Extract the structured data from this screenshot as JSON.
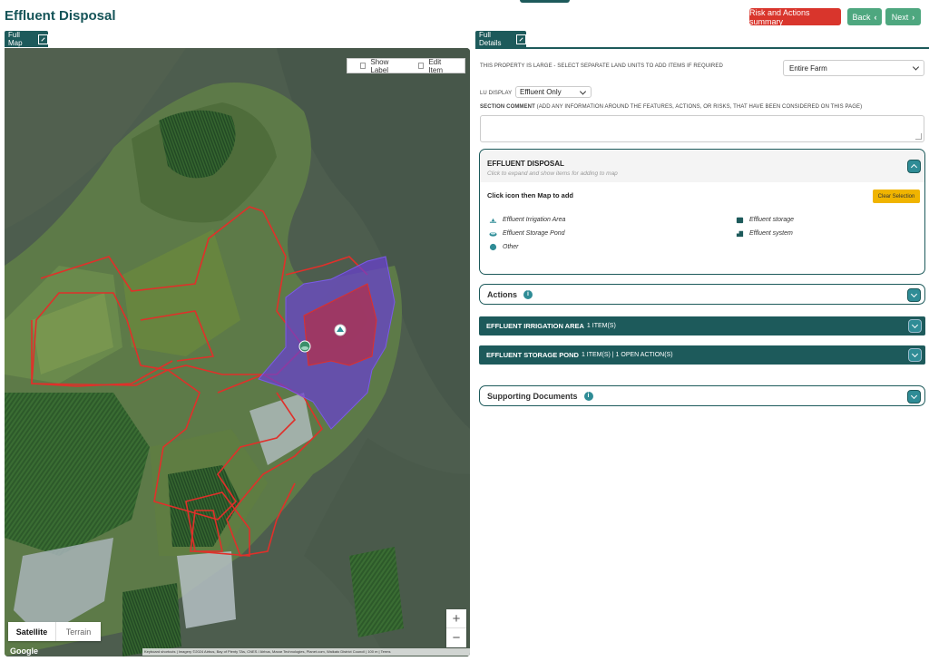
{
  "header": {
    "title": "Effluent Disposal",
    "risk_button": "Risk and Actions summary",
    "back_button": "Back",
    "next_button": "Next"
  },
  "tabs": {
    "map": "Full Map",
    "details": "Full Details"
  },
  "map": {
    "show_label": "Show Label",
    "edit_item": "Edit Item",
    "map_type_satellite": "Satellite",
    "map_type_terrain": "Terrain",
    "zoom_in": "+",
    "zoom_out": "−",
    "google": "Google",
    "attribution": "Keyboard shortcuts | Imagery ©2024 Airbus, Bay of Plenty TAs, CNES / Airbus, Maxar Technologies, Planet.com, Waikato District Council | 100 m | Terms"
  },
  "details": {
    "land_units_label": "THIS PROPERTY IS LARGE - SELECT SEPARATE LAND UNITS TO ADD ITEMS IF REQUIRED",
    "land_units_value": "Entire Farm",
    "lu_display_label": "LU DISPLAY",
    "lu_display_value": "Effluent Only",
    "section_comment_bold": "SECTION COMMENT",
    "section_comment_rest": " (ADD ANY INFORMATION AROUND THE FEATURES, ACTIONS, OR RISKS, THAT HAVE BEEN CONSIDERED ON THIS PAGE)"
  },
  "effluent_panel": {
    "title": "EFFLUENT DISPOSAL",
    "subtitle": "Click to expand and show items for adding to map",
    "instruction": "Click icon then Map to add",
    "clear_button": "Clear Selection",
    "items": [
      {
        "label": "Effluent Irrigation Area",
        "icon": "irrigation-icon"
      },
      {
        "label": "Effluent storage",
        "icon": "storage-icon"
      },
      {
        "label": "Effluent Storage Pond",
        "icon": "pond-icon"
      },
      {
        "label": "Effluent system",
        "icon": "system-icon"
      },
      {
        "label": "Other",
        "icon": "other-icon"
      }
    ]
  },
  "accordions": {
    "actions": "Actions",
    "irrigation_title": "EFFLUENT IRRIGATION AREA",
    "irrigation_extra": "1 ITEM(S)",
    "pond_title": "EFFLUENT STORAGE POND",
    "pond_extra": "1 ITEM(S) | 1 OPEN ACTION(S)",
    "documents": "Supporting Documents"
  },
  "colors": {
    "primary": "#1d5a5b",
    "danger": "#d9352c",
    "success": "#4ea77f",
    "warning": "#f0b400",
    "polygon_red": "#e0302a",
    "polygon_purple": "#6a3fd4"
  }
}
